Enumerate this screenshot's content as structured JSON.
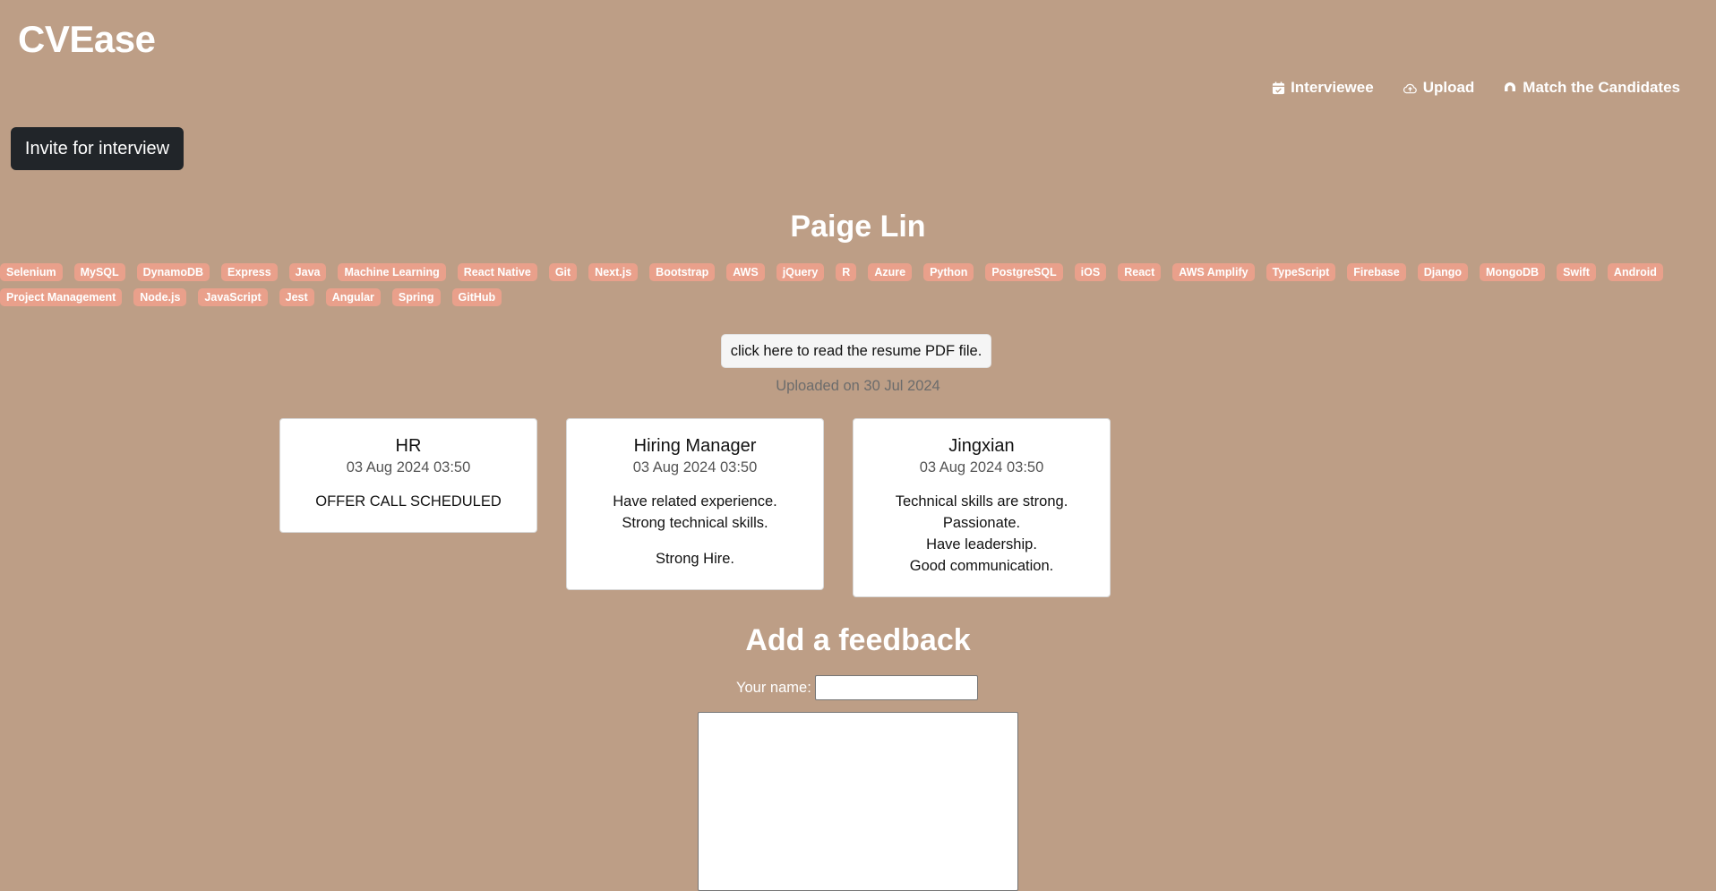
{
  "app": {
    "title": "CVEase"
  },
  "nav": {
    "interviewee": "Interviewee",
    "upload": "Upload",
    "match": "Match the Candidates"
  },
  "actions": {
    "invite": "Invite for interview",
    "resume": "click here to read the resume PDF file."
  },
  "candidate": {
    "name": "Paige Lin",
    "uploaded": "Uploaded on 30 Jul 2024",
    "skills": [
      "Selenium",
      "MySQL",
      "DynamoDB",
      "Express",
      "Java",
      "Machine Learning",
      "React Native",
      "Git",
      "Next.js",
      "Bootstrap",
      "AWS",
      "jQuery",
      "R",
      "Azure",
      "Python",
      "PostgreSQL",
      "iOS",
      "React",
      "AWS Amplify",
      "TypeScript",
      "Firebase",
      "Django",
      "MongoDB",
      "Swift",
      "Android",
      "Project Management",
      "Node.js",
      "JavaScript",
      "Jest",
      "Angular",
      "Spring",
      "GitHub"
    ]
  },
  "feedbacks": [
    {
      "author": "HR",
      "date": "03 Aug 2024 03:50",
      "lines": [
        "OFFER CALL SCHEDULED"
      ]
    },
    {
      "author": "Hiring Manager",
      "date": "03 Aug 2024 03:50",
      "lines": [
        "Have related experience.",
        "Strong technical skills.",
        "",
        "Strong Hire."
      ]
    },
    {
      "author": "Jingxian",
      "date": "03 Aug 2024 03:50",
      "lines": [
        "Technical skills are strong.",
        "Passionate.",
        "Have leadership.",
        "Good communication."
      ]
    }
  ],
  "feedback_form": {
    "title": "Add a feedback",
    "name_label": "Your name:",
    "name_value": "",
    "comment_value": ""
  },
  "colors": {
    "background": "#bd9e86",
    "tag": "#e9a08b",
    "invite_button": "#212529"
  },
  "icons": {
    "interviewee": "calendar-icon",
    "upload": "cloud-upload-icon",
    "match": "magnet-icon"
  }
}
